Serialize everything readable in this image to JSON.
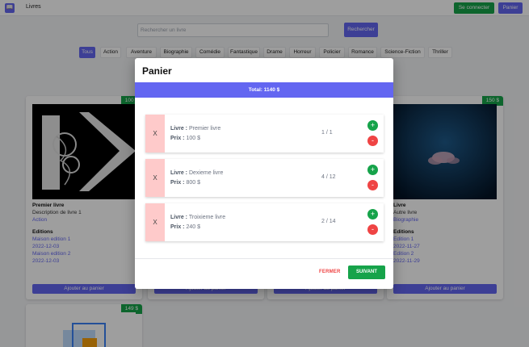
{
  "header": {
    "brand_icon": "book-icon",
    "title": "Livres",
    "login_label": "Se connecter",
    "cart_label": "Panier"
  },
  "search": {
    "placeholder": "Rechercher un livre",
    "button_label": "Rechercher"
  },
  "categories": [
    "Tous",
    "Action",
    "Aventure",
    "Biographie",
    "Comédie",
    "Fantastique",
    "Drame",
    "Horreur",
    "Policier",
    "Romance",
    "Science-Fiction",
    "Thriller"
  ],
  "active_category": "Tous",
  "cards": {
    "first": {
      "price": "100 $",
      "title": "Premier livre",
      "description": "Description de livre 1",
      "category": "Action",
      "editions_label": "Editions",
      "editions": [
        {
          "name": "Maison edition 1",
          "date": "2022-12-03"
        },
        {
          "name": "Maison edition 2",
          "date": "2022-12-03"
        }
      ],
      "add_label": "Ajouter au panier"
    },
    "second": {
      "add_label": "Ajouter au panier"
    },
    "third": {
      "add_label": "Ajouter au panier"
    },
    "fourth": {
      "price": "150 $",
      "title": "Livre",
      "description": "Autre livre",
      "category": "Biographie",
      "editions_label": "Editions",
      "editions": [
        {
          "name": "Edition 1",
          "date": "2022-11-27"
        },
        {
          "name": "Edition 2",
          "date": "2022-11-29"
        }
      ],
      "add_label": "Ajouter au panier"
    },
    "fifth": {
      "price": "149 $"
    }
  },
  "modal": {
    "title": "Panier",
    "total": "Total: 1140 $",
    "items": [
      {
        "remove": "X",
        "book_label": "Livre :",
        "book": "Premier livre",
        "price_label": "Prix :",
        "price": "100 $",
        "qty": "1 / 1",
        "plus": "+",
        "minus": "-"
      },
      {
        "remove": "X",
        "book_label": "Livre :",
        "book": "Dexieme livre",
        "price_label": "Prix :",
        "price": "800 $",
        "qty": "4 / 12",
        "plus": "+",
        "minus": "-"
      },
      {
        "remove": "X",
        "book_label": "Livre :",
        "book": "Troixieme livre",
        "price_label": "Prix :",
        "price": "240 $",
        "qty": "2 / 14",
        "plus": "+",
        "minus": "-"
      }
    ],
    "close_label": "FERMER",
    "next_label": "SUIVANT"
  },
  "colors": {
    "primary": "#6366f1",
    "success": "#16a34a",
    "danger": "#ef4444",
    "remove_bg": "#fecaca"
  }
}
